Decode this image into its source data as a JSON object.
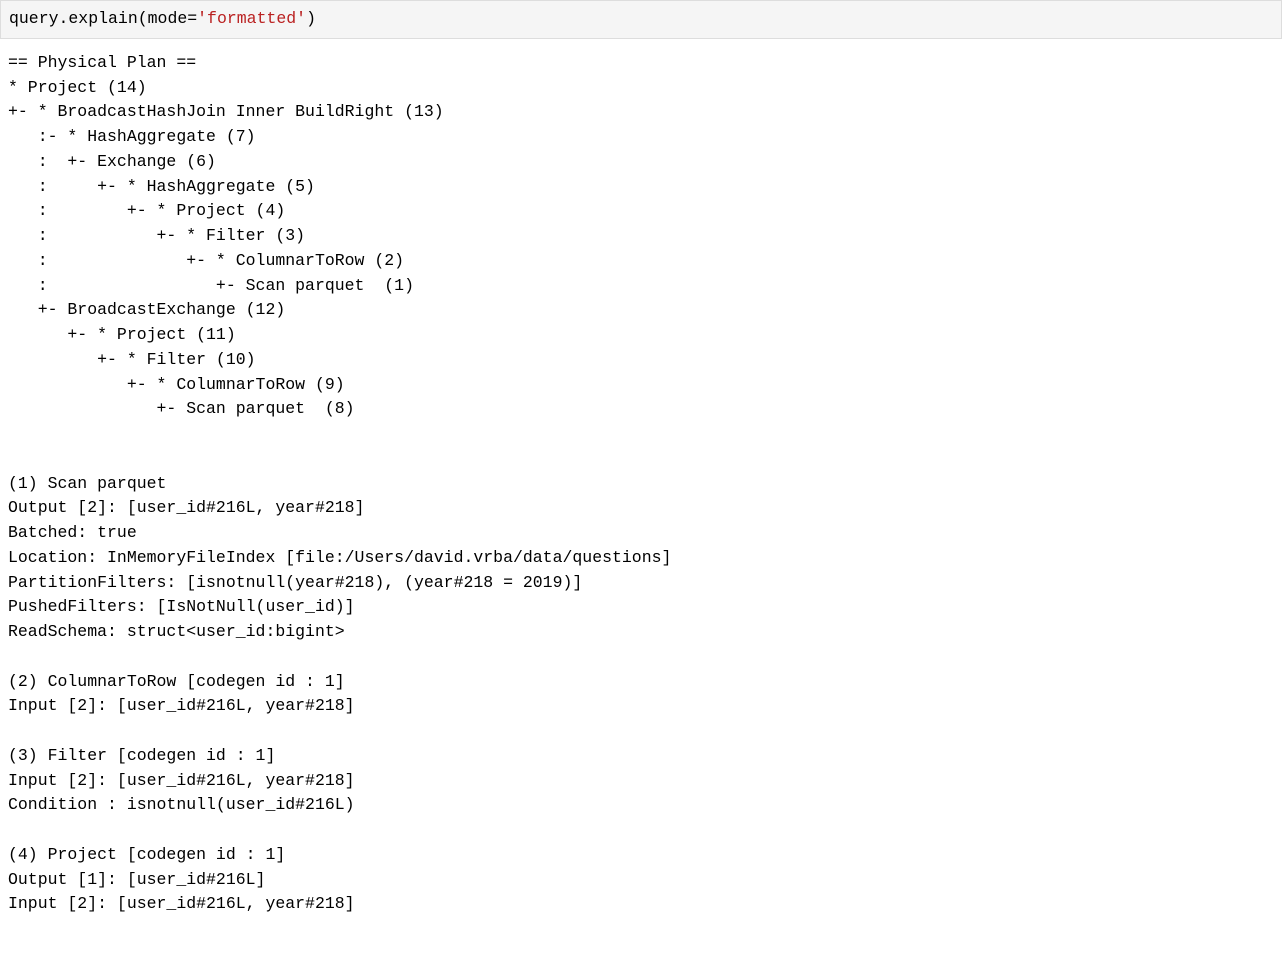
{
  "header": {
    "call": "query.explain",
    "open_paren": "(",
    "arg": "mode",
    "eq": "=",
    "str": "'formatted'",
    "close_paren": ")"
  },
  "plan_lines": [
    "== Physical Plan ==",
    "* Project (14)",
    "+- * BroadcastHashJoin Inner BuildRight (13)",
    "   :- * HashAggregate (7)",
    "   :  +- Exchange (6)",
    "   :     +- * HashAggregate (5)",
    "   :        +- * Project (4)",
    "   :           +- * Filter (3)",
    "   :              +- * ColumnarToRow (2)",
    "   :                 +- Scan parquet  (1)",
    "   +- BroadcastExchange (12)",
    "      +- * Project (11)",
    "         +- * Filter (10)",
    "            +- * ColumnarToRow (9)",
    "               +- Scan parquet  (8)",
    "",
    "",
    "(1) Scan parquet ",
    "Output [2]: [user_id#216L, year#218]",
    "Batched: true",
    "Location: InMemoryFileIndex [file:/Users/david.vrba/data/questions]",
    "PartitionFilters: [isnotnull(year#218), (year#218 = 2019)]",
    "PushedFilters: [IsNotNull(user_id)]",
    "ReadSchema: struct<user_id:bigint>",
    "",
    "(2) ColumnarToRow [codegen id : 1]",
    "Input [2]: [user_id#216L, year#218]",
    "",
    "(3) Filter [codegen id : 1]",
    "Input [2]: [user_id#216L, year#218]",
    "Condition : isnotnull(user_id#216L)",
    "",
    "(4) Project [codegen id : 1]",
    "Output [1]: [user_id#216L]",
    "Input [2]: [user_id#216L, year#218]"
  ]
}
